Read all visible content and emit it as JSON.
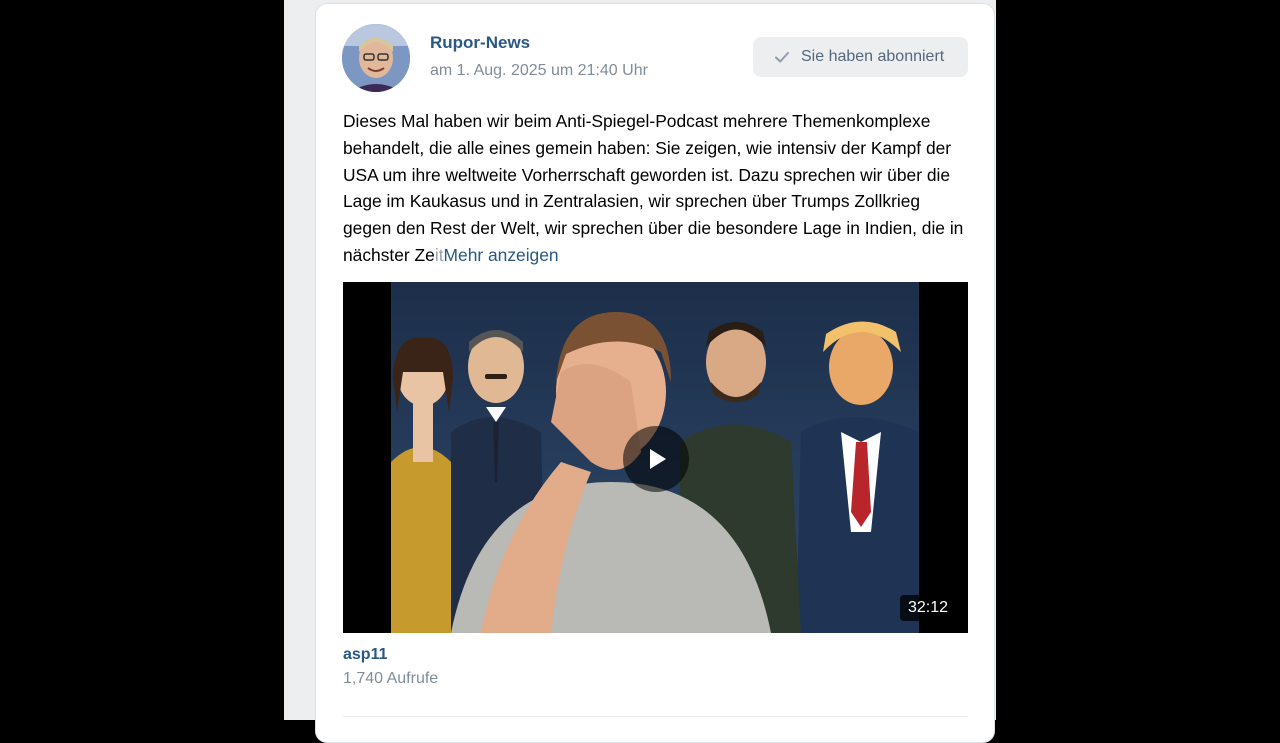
{
  "post": {
    "author": "Rupor-News",
    "date": "am 1. Aug. 2025 um 21:40 Uhr",
    "subscribe_label": "Sie haben abonniert",
    "text_main": "Dieses Mal haben wir beim Anti-Spiegel-Podcast mehrere Themenkomplexe behandelt, die alle eines gemein haben: Sie zeigen, wie intensiv der Kampf der USA um ihre weltweite Vorherrschaft geworden ist. Dazu sprechen wir über die Lage im Kaukasus und in Zentralasien, wir sprechen über Trumps Zollkrieg gegen den Rest der Welt, wir sprechen über die besondere Lage in Indien, die in nächster Ze",
    "text_fade": "it",
    "show_more": "Mehr anzeigen"
  },
  "video": {
    "duration": "32:12",
    "title": "asp11",
    "views": "1,740 Aufrufe"
  },
  "icons": {
    "check": "check-icon",
    "play": "play-icon"
  },
  "colors": {
    "link": "#2a5885",
    "muted": "#818c99",
    "button_bg": "#edeef0"
  }
}
